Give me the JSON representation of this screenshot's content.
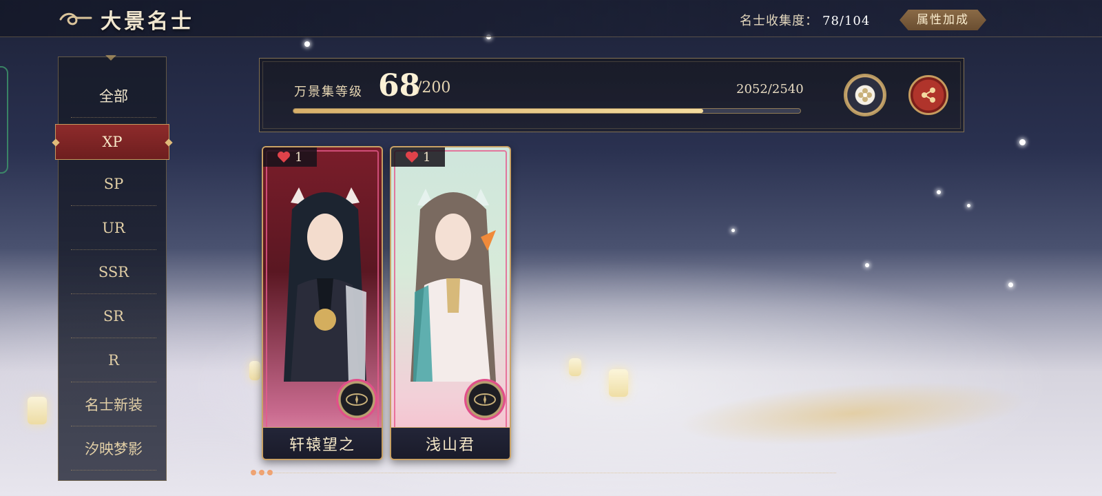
{
  "header": {
    "title": "大景名士",
    "collection_label": "名士收集度：",
    "collection_value": "78/104",
    "attr_button_label": "属性加成"
  },
  "sidebar": {
    "selected": "XP",
    "items": [
      {
        "label": "全部"
      },
      {
        "label": "XP"
      },
      {
        "label": "SP"
      },
      {
        "label": "UR"
      },
      {
        "label": "SSR"
      },
      {
        "label": "SR"
      },
      {
        "label": "R"
      },
      {
        "label": "名士新装"
      },
      {
        "label": "汐映梦影"
      }
    ]
  },
  "level_panel": {
    "label": "万景集等级",
    "level": "68",
    "level_max": "/200",
    "exp_text": "2052/2540",
    "progress_fraction": 0.808
  },
  "cards": [
    {
      "name": "轩辕望之",
      "affection": "1"
    },
    {
      "name": "浅山君",
      "affection": "1"
    }
  ],
  "colors": {
    "accent_gold": "#c9a265",
    "selected_red": "#8e2b2b",
    "progress_gold": "#e7c882"
  }
}
